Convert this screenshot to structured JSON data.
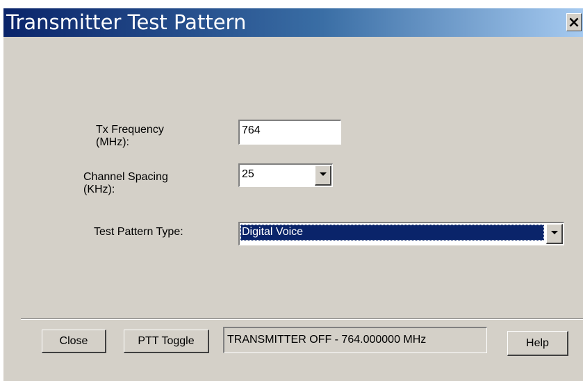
{
  "window": {
    "title": "Transmitter Test Pattern",
    "close_glyph": "×"
  },
  "form": {
    "tx_frequency": {
      "label": "Tx Frequency\n(MHz):",
      "value": "764"
    },
    "channel_spacing": {
      "label": "Channel Spacing\n(KHz):",
      "value": "25"
    },
    "test_pattern_type": {
      "label": "Test  Pattern Type:",
      "value": "Digital Voice"
    }
  },
  "footer": {
    "close_label": "Close",
    "ptt_toggle_label": "PTT Toggle",
    "status_text": "TRANSMITTER OFF - 764.000000 MHz",
    "help_label": "Help"
  },
  "icons": {
    "window_close": "close-icon",
    "dropdown": "chevron-down-icon"
  },
  "colors": {
    "titlebar_start": "#0a246a",
    "titlebar_end": "#a6caf0",
    "face": "#d4d0c8",
    "selection": "#0a246a"
  }
}
